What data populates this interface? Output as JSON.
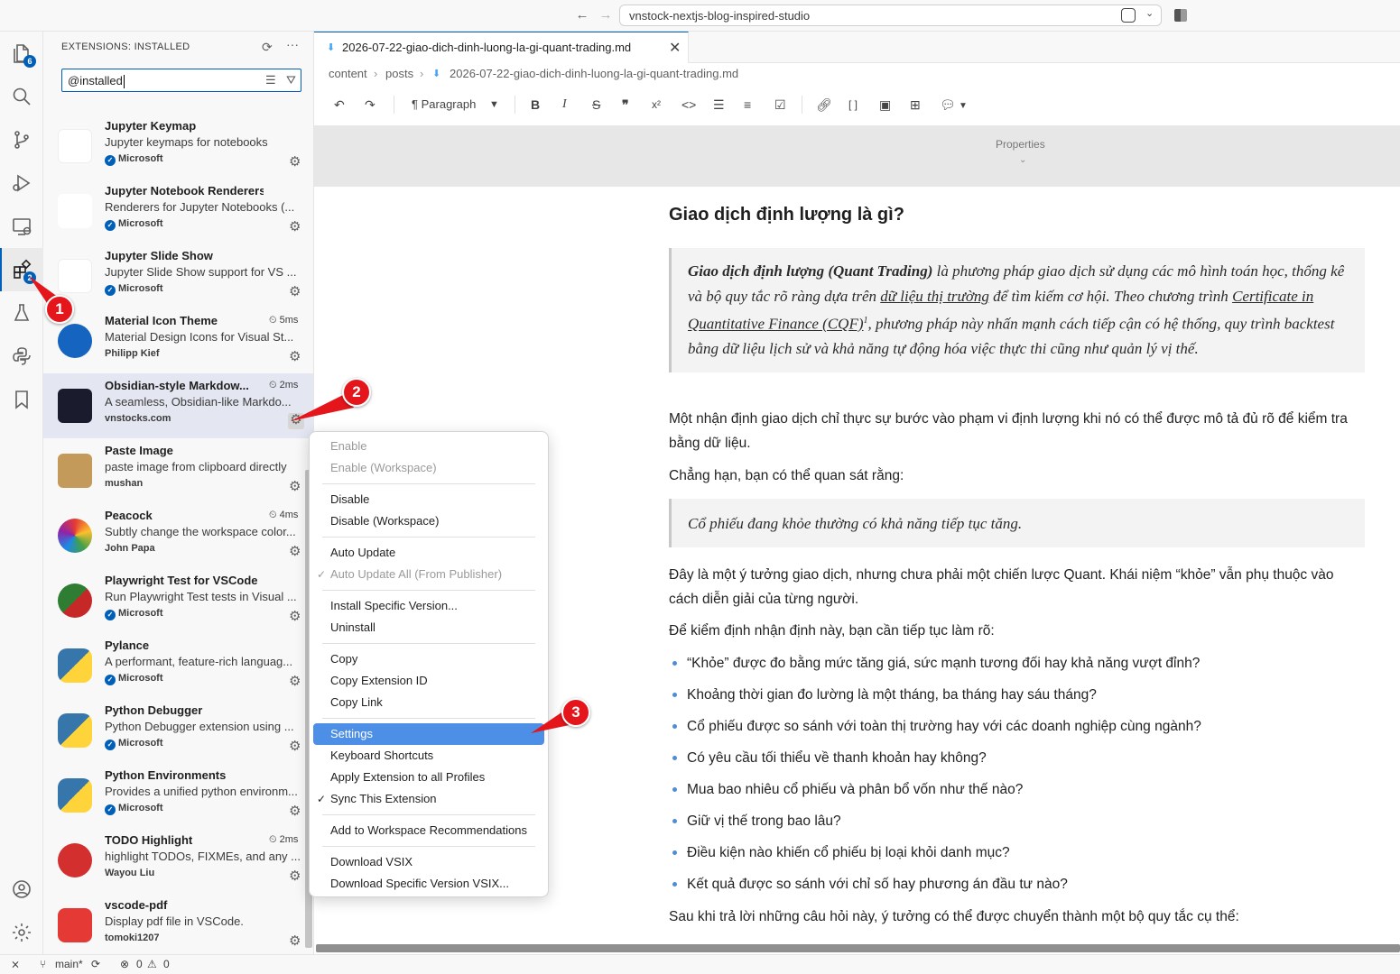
{
  "titlebar": {
    "back_icon": "arrow-left-icon",
    "forward_icon": "arrow-right-icon",
    "command_center": "vnstock-nextjs-blog-inspired-studio"
  },
  "activity_bar": {
    "explorer_badge": "6",
    "extensions_badge": "2"
  },
  "sidebar": {
    "title": "EXTENSIONS: INSTALLED",
    "search_value": "@installed",
    "extensions": [
      {
        "name": "Jupyter Keymap",
        "desc": "Jupyter keymaps for notebooks",
        "publisher": "Microsoft",
        "verified": true,
        "time": ""
      },
      {
        "name": "Jupyter Notebook Renderers",
        "desc": "Renderers for Jupyter Notebooks (...",
        "publisher": "Microsoft",
        "verified": true,
        "time": ""
      },
      {
        "name": "Jupyter Slide Show",
        "desc": "Jupyter Slide Show support for VS ...",
        "publisher": "Microsoft",
        "verified": true,
        "time": ""
      },
      {
        "name": "Material Icon Theme",
        "desc": "Material Design Icons for Visual St...",
        "publisher": "Philipp Kief",
        "verified": false,
        "time": "5ms"
      },
      {
        "name": "Obsidian-style Markdow...",
        "desc": "A seamless, Obsidian-like Markdo...",
        "publisher": "vnstocks.com",
        "verified": false,
        "time": "2ms"
      },
      {
        "name": "Paste Image",
        "desc": "paste image from clipboard directly",
        "publisher": "mushan",
        "verified": false,
        "time": ""
      },
      {
        "name": "Peacock",
        "desc": "Subtly change the workspace color...",
        "publisher": "John Papa",
        "verified": false,
        "time": "4ms"
      },
      {
        "name": "Playwright Test for VSCode",
        "desc": "Run Playwright Test tests in Visual ...",
        "publisher": "Microsoft",
        "verified": true,
        "time": ""
      },
      {
        "name": "Pylance",
        "desc": "A performant, feature-rich languag...",
        "publisher": "Microsoft",
        "verified": true,
        "time": ""
      },
      {
        "name": "Python Debugger",
        "desc": "Python Debugger extension using ...",
        "publisher": "Microsoft",
        "verified": true,
        "time": ""
      },
      {
        "name": "Python Environments",
        "desc": "Provides a unified python environm...",
        "publisher": "Microsoft",
        "verified": true,
        "time": ""
      },
      {
        "name": "TODO Highlight",
        "desc": "highlight TODOs, FIXMEs, and any ...",
        "publisher": "Wayou Liu",
        "verified": false,
        "time": "2ms"
      },
      {
        "name": "vscode-pdf",
        "desc": "Display pdf file in VSCode.",
        "publisher": "tomoki1207",
        "verified": false,
        "time": ""
      }
    ]
  },
  "editor": {
    "tab_title": "2026-07-22-giao-dich-dinh-luong-la-gi-quant-trading.md",
    "breadcrumb": [
      "content",
      "posts",
      "2026-07-22-giao-dich-dinh-luong-la-gi-quant-trading.md"
    ],
    "toolbar_block_type": "Paragraph",
    "properties_label": "Properties",
    "heading": "Giao dịch định lượng là gì?",
    "quote1": {
      "bold": "Giao dịch định lượng (Quant Trading)",
      "t1": " là phương pháp giao dịch sử dụng các mô hình toán học, thống kê và bộ quy tắc rõ ràng dựa trên ",
      "link1": "dữ liệu thị trường",
      "t2": " để tìm kiếm cơ hội. Theo chương trình ",
      "link2": "Certificate in Quantitative Finance (CQF)",
      "sup": "1",
      "t3": ", phương pháp này nhấn mạnh cách tiếp cận có hệ thống, quy trình backtest bằng dữ liệu lịch sử và khả năng tự động hóa việc thực thi cũng như quản lý vị thế."
    },
    "para1": "Một nhận định giao dịch chỉ thực sự bước vào phạm vi định lượng khi nó có thể được mô tả đủ rõ để kiểm tra bằng dữ liệu.",
    "para2": "Chẳng hạn, bạn có thể quan sát rằng:",
    "quote2": "Cổ phiếu đang khỏe thường có khả năng tiếp tục tăng.",
    "para3": "Đây là một ý tưởng giao dịch, nhưng chưa phải một chiến lược Quant. Khái niệm “khỏe” vẫn phụ thuộc vào cách diễn giải của từng người.",
    "para4": "Để kiểm định nhận định này, bạn cần tiếp tục làm rõ:",
    "bullets": [
      "“Khỏe” được đo bằng mức tăng giá, sức mạnh tương đối hay khả năng vượt đỉnh?",
      "Khoảng thời gian đo lường là một tháng, ba tháng hay sáu tháng?",
      "Cổ phiếu được so sánh với toàn thị trường hay với các doanh nghiệp cùng ngành?",
      "Có yêu cầu tối thiểu về thanh khoản hay không?",
      "Mua bao nhiêu cổ phiếu và phân bổ vốn như thế nào?",
      "Giữ vị thế trong bao lâu?",
      "Điều kiện nào khiến cổ phiếu bị loại khỏi danh mục?",
      "Kết quả được so sánh với chỉ số hay phương án đầu tư nào?"
    ],
    "para5": "Sau khi trả lời những câu hỏi này, ý tưởng có thể được chuyển thành một bộ quy tắc cụ thể:"
  },
  "context_menu": {
    "items": [
      {
        "label": "Enable",
        "disabled": true
      },
      {
        "label": "Enable (Workspace)",
        "disabled": true
      },
      {
        "label": "Disable"
      },
      {
        "label": "Disable (Workspace)"
      },
      {
        "label": "Auto Update"
      },
      {
        "label": "Auto Update All (From Publisher)",
        "disabled": true,
        "checked": true
      },
      {
        "label": "Install Specific Version..."
      },
      {
        "label": "Uninstall"
      },
      {
        "label": "Copy"
      },
      {
        "label": "Copy Extension ID"
      },
      {
        "label": "Copy Link"
      },
      {
        "label": "Settings",
        "highlighted": true
      },
      {
        "label": "Keyboard Shortcuts"
      },
      {
        "label": "Apply Extension to all Profiles"
      },
      {
        "label": "Sync This Extension",
        "checked": true
      },
      {
        "label": "Add to Workspace Recommendations"
      },
      {
        "label": "Download VSIX"
      },
      {
        "label": "Download Specific Version VSIX..."
      }
    ]
  },
  "statusbar": {
    "branch": "main*",
    "errors": "0",
    "warnings": "0"
  },
  "annotations": [
    "1",
    "2",
    "3"
  ],
  "colors": {
    "accent": "#005fb8",
    "marker": "#e4161c",
    "menu_highlight": "#4d8fe6"
  }
}
